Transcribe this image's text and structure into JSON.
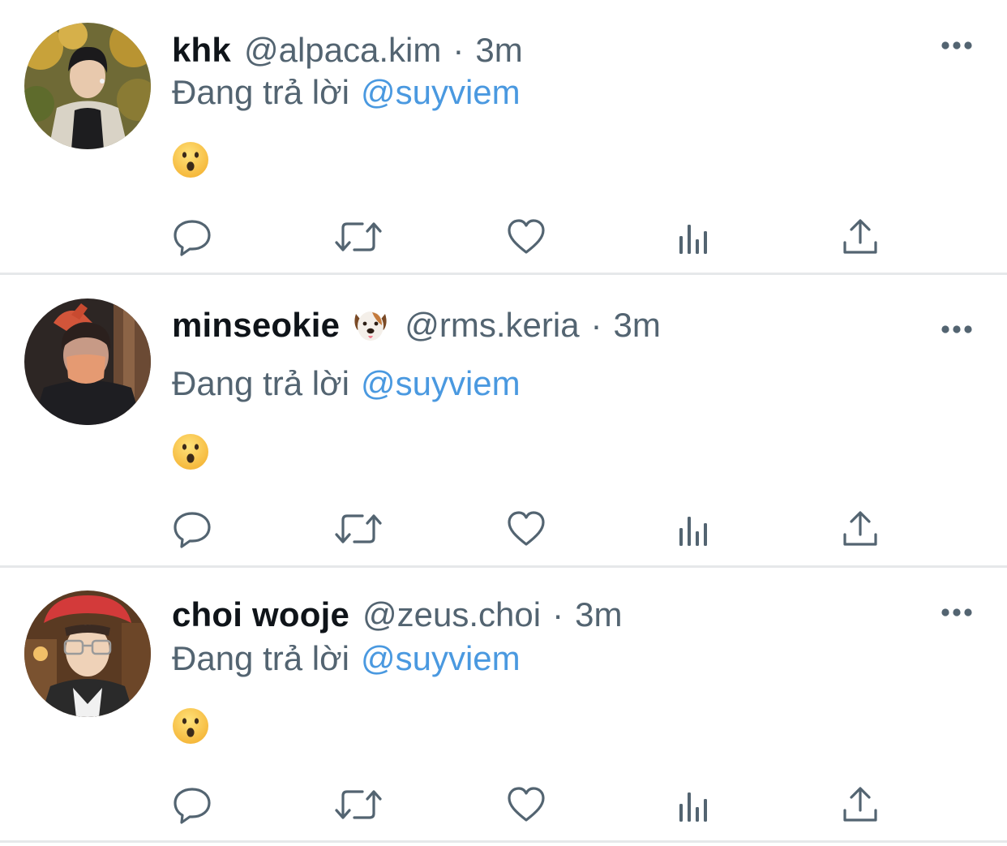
{
  "reply_prefix": "Đang trả lời",
  "colors": {
    "name": "#0f1419",
    "secondary": "#536471",
    "mention": "#4a99e0",
    "separator": "#e6e8ea",
    "icon": "#536471"
  },
  "icons": {
    "more": "more-horizontal-icon",
    "reply": "reply-bubble-icon",
    "retweet": "retweet-icon",
    "like": "heart-icon",
    "views": "bar-chart-icon",
    "share": "share-upload-icon",
    "body_emoji": "hushed-face-emoji",
    "name_emoji": "dog-face-emoji"
  },
  "tweets": [
    {
      "name": "khk",
      "handle": "@alpaca.kim",
      "separator": "·",
      "time": "3m",
      "mention": "@suyviem"
    },
    {
      "name": "minseokie",
      "handle": "@rms.keria",
      "separator": "·",
      "time": "3m",
      "mention": "@suyviem"
    },
    {
      "name": "choi wooje",
      "handle": "@zeus.choi",
      "separator": "·",
      "time": "3m",
      "mention": "@suyviem"
    }
  ]
}
